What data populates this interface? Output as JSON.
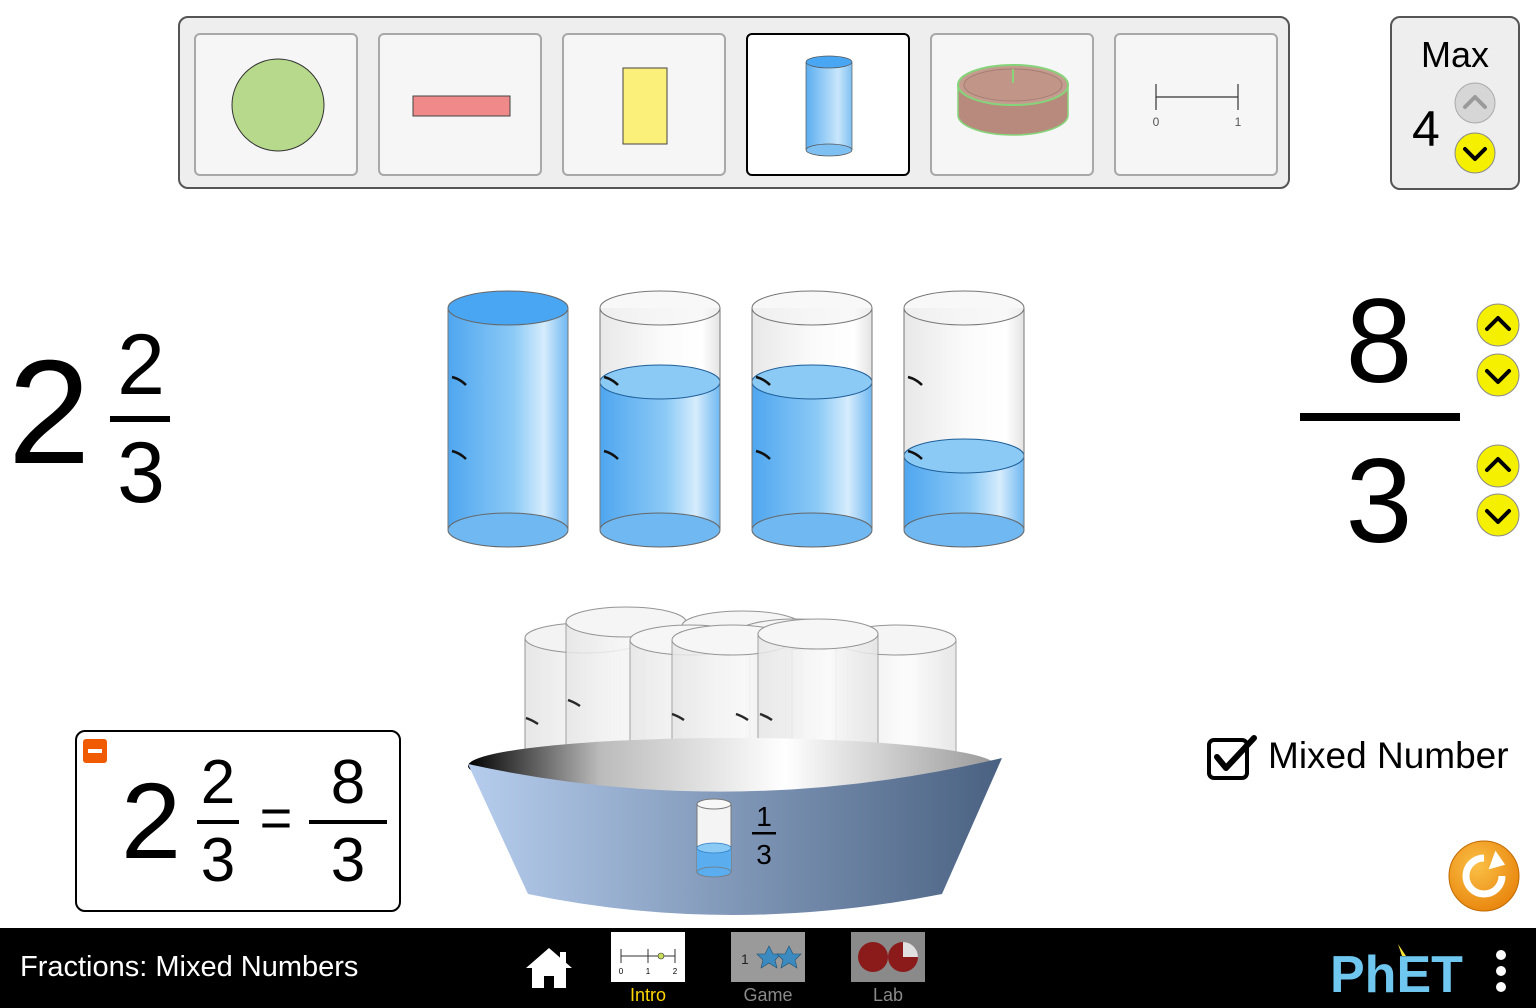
{
  "representations": [
    {
      "name": "circle",
      "selected": false
    },
    {
      "name": "bar",
      "selected": false
    },
    {
      "name": "rectangle",
      "selected": false
    },
    {
      "name": "beaker",
      "selected": true
    },
    {
      "name": "cake",
      "selected": false
    },
    {
      "name": "number-line",
      "selected": false,
      "tick_labels": [
        "0",
        "1"
      ]
    }
  ],
  "max": {
    "label": "Max",
    "value": "4"
  },
  "mixed_number": {
    "whole": "2",
    "numerator": "2",
    "denominator": "3"
  },
  "improper_fraction": {
    "numerator": "8",
    "denominator": "3"
  },
  "containers": {
    "count": 4,
    "fill_levels": [
      1.0,
      0.6667,
      0.6667,
      0.3333
    ],
    "divisions": 3
  },
  "bucket": {
    "piece_numerator": "1",
    "piece_denominator": "3"
  },
  "equation": {
    "whole": "2",
    "numerator": "2",
    "denominator": "3",
    "equals": "=",
    "rhs_numerator": "8",
    "rhs_denominator": "3"
  },
  "mixed_number_toggle": {
    "label": "Mixed Number",
    "checked": true
  },
  "colors": {
    "water": "#5aaef0",
    "spinner_yellow": "#f4f000",
    "reset_orange": "#f39c1a",
    "minus_orange": "#f05a00"
  },
  "navbar": {
    "title": "Fractions: Mixed Numbers",
    "screens": [
      {
        "label": "Intro",
        "selected": true
      },
      {
        "label": "Game",
        "selected": false
      },
      {
        "label": "Lab",
        "selected": false
      }
    ],
    "intro_icon_ticks": [
      "0",
      "1",
      "2"
    ],
    "game_icon_text": "1",
    "brand": "PhET"
  }
}
